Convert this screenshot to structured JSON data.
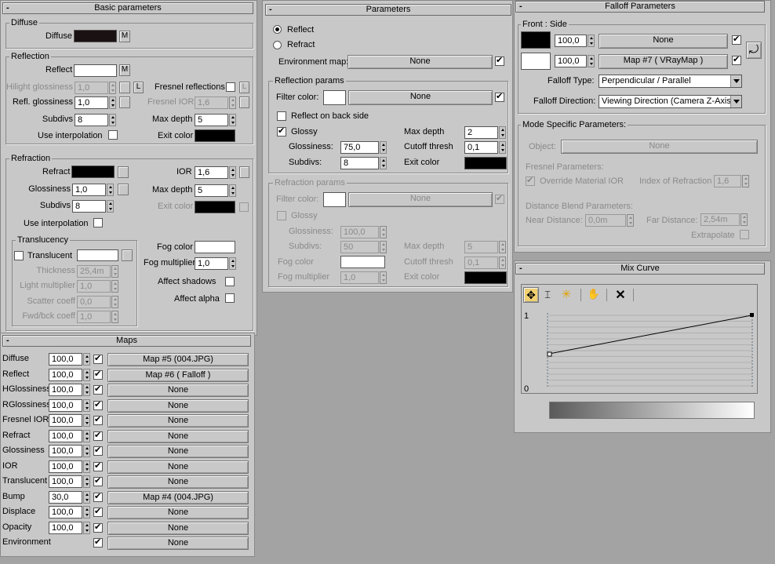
{
  "basic": {
    "title": "Basic parameters",
    "toggle": "-",
    "diffuse": {
      "group": "Diffuse",
      "label": "Diffuse",
      "m": "M",
      "color": "#1a1212"
    },
    "reflection": {
      "group": "Reflection",
      "reflect_label": "Reflect",
      "m": "M",
      "reflect_color": "#ffffff",
      "hilight_label": "Hilight glossiness",
      "hilight_val": "1,0",
      "l": "L",
      "fresnel_label": "Fresnel reflections",
      "fresnel_l": "L",
      "refl_gloss_label": "Refl. glossiness",
      "refl_gloss_val": "1,0",
      "fresnel_ior_label": "Fresnel IOR",
      "fresnel_ior_val": "1,6",
      "subdivs_label": "Subdivs",
      "subdivs_val": "8",
      "maxdepth_label": "Max depth",
      "maxdepth_val": "5",
      "interp_label": "Use interpolation",
      "exit_label": "Exit color",
      "exit_color": "#000000"
    },
    "refraction": {
      "group": "Refraction",
      "refract_label": "Refract",
      "refract_color": "#000000",
      "ior_label": "IOR",
      "ior_val": "1,6",
      "gloss_label": "Glossiness",
      "gloss_val": "1,0",
      "maxdepth_label": "Max depth",
      "maxdepth_val": "5",
      "subdivs_label": "Subdivs",
      "subdivs_val": "8",
      "exit_label": "Exit color",
      "exit_color": "#000000",
      "interp_label": "Use interpolation",
      "translucency": {
        "group": "Translucency",
        "translucent_label": "Translucent",
        "thickness_label": "Thickness",
        "thickness_val": "25,4m",
        "light_label": "Light multiplier",
        "light_val": "1,0",
        "scatter_label": "Scatter coeff",
        "scatter_val": "0,0",
        "fwd_label": "Fwd/bck coeff",
        "fwd_val": "1,0"
      },
      "fog_color_label": "Fog color",
      "fog_mult_label": "Fog multiplier",
      "fog_mult_val": "1,0",
      "shadows_label": "Affect shadows",
      "alpha_label": "Affect alpha"
    }
  },
  "maps": {
    "title": "Maps",
    "toggle": "-",
    "rows": [
      {
        "name": "Diffuse",
        "val": "100,0",
        "map": "Map #5 (004.JPG)"
      },
      {
        "name": "Reflect",
        "val": "100,0",
        "map": "Map #6  ( Falloff )"
      },
      {
        "name": "HGlossiness",
        "val": "100,0",
        "map": "None"
      },
      {
        "name": "RGlossiness",
        "val": "100,0",
        "map": "None"
      },
      {
        "name": "Fresnel IOR",
        "val": "100,0",
        "map": "None"
      },
      {
        "name": "Refract",
        "val": "100,0",
        "map": "None"
      },
      {
        "name": "Glossiness",
        "val": "100,0",
        "map": "None"
      },
      {
        "name": "IOR",
        "val": "100,0",
        "map": "None"
      },
      {
        "name": "Translucent",
        "val": "100,0",
        "map": "None"
      },
      {
        "name": "Bump",
        "val": "30,0",
        "map": "Map #4 (004.JPG)"
      },
      {
        "name": "Displace",
        "val": "100,0",
        "map": "None"
      },
      {
        "name": "Opacity",
        "val": "100,0",
        "map": "None"
      },
      {
        "name": "Environment",
        "val": "",
        "map": "None"
      }
    ]
  },
  "params": {
    "title": "Parameters",
    "toggle": "-",
    "reflect_radio": "Reflect",
    "refract_radio": "Refract",
    "env_label": "Environment map:",
    "env_map": "None",
    "refl_group": "Reflection params",
    "filter_label": "Filter color:",
    "filter_map": "None",
    "back_label": "Reflect on back side",
    "glossy_label": "Glossy",
    "maxdepth_label": "Max depth",
    "maxdepth_val": "2",
    "gloss_label": "Glossiness:",
    "gloss_val": "75,0",
    "cutoff_label": "Cutoff thresh",
    "cutoff_val": "0,1",
    "subdivs_label": "Subdivs:",
    "subdivs_val": "8",
    "exit_label": "Exit color",
    "refr_group": "Refraction params",
    "r_filter_label": "Filter color:",
    "r_filter_map": "None",
    "r_glossy_label": "Glossy",
    "r_gloss_label": "Glossiness:",
    "r_gloss_val": "100,0",
    "r_subdivs_label": "Subdivs:",
    "r_subdivs_val": "50",
    "r_maxdepth_label": "Max depth",
    "r_maxdepth_val": "5",
    "r_cutoff_label": "Cutoff thresh",
    "r_cutoff_val": "0,1",
    "fog_label": "Fog color",
    "fogm_label": "Fog multiplier",
    "fogm_val": "1,0",
    "r_exit_label": "Exit color"
  },
  "falloff": {
    "title": "Falloff Parameters",
    "toggle": "-",
    "front_side": "Front : Side",
    "v1": "100,0",
    "m1": "None",
    "v2": "100,0",
    "m2": "Map #7  ( VRayMap )",
    "type_label": "Falloff Type:",
    "type_val": "Perpendicular / Parallel",
    "dir_label": "Falloff Direction:",
    "dir_val": "Viewing Direction (Camera Z-Axis)",
    "mode_group": "Mode Specific Parameters:",
    "object_label": "Object:",
    "object_val": "None",
    "fresnel_group": "Fresnel Parameters:",
    "override_label": "Override Material IOR",
    "ior_label": "Index of Refraction",
    "ior_val": "1,6",
    "dist_group": "Distance Blend Parameters:",
    "near_label": "Near Distance:",
    "near_val": "0,0m",
    "far_label": "Far Distance:",
    "far_val": "2,54m",
    "extra_label": "Extrapolate"
  },
  "mix": {
    "title": "Mix Curve",
    "toggle": "-",
    "y1": "1",
    "y0": "0"
  }
}
